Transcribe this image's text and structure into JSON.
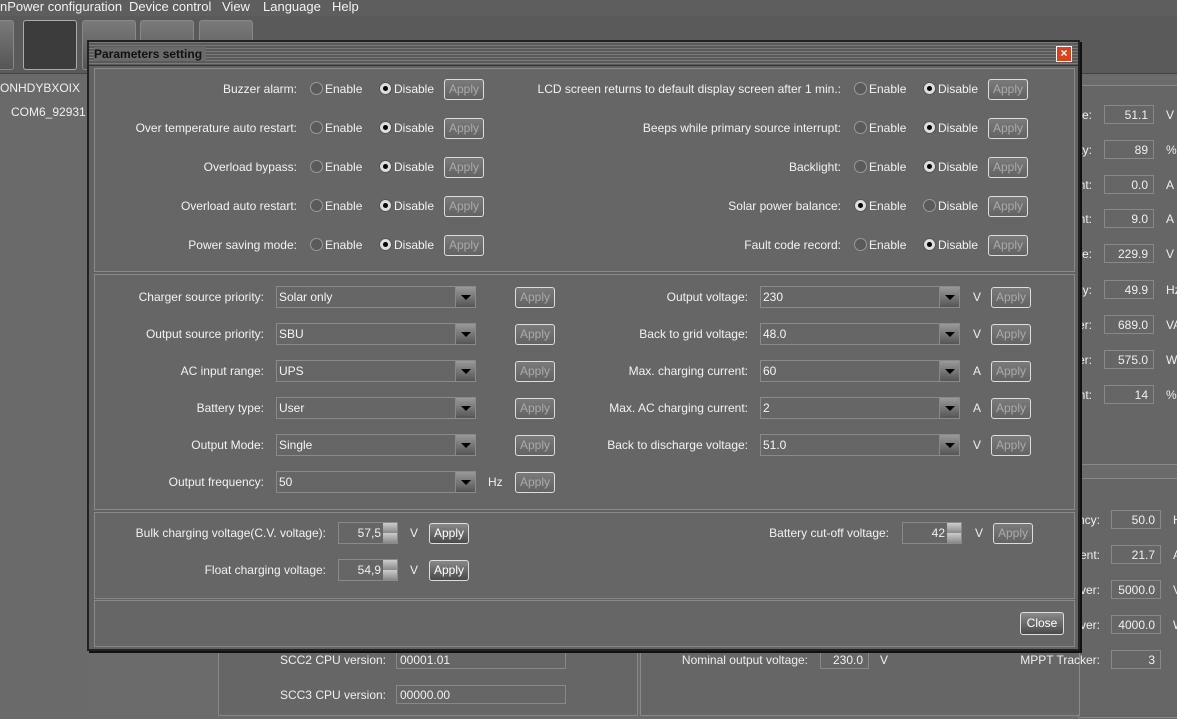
{
  "menu": [
    "nPower configuration",
    "Device control",
    "View",
    "Language",
    "Help"
  ],
  "tree": {
    "root": "ONHDYBXOIX",
    "device": "COM6_92931"
  },
  "background_right_top": [
    {
      "label": "e:",
      "value": "51.1",
      "unit": "V"
    },
    {
      "label": "ty:",
      "value": "89",
      "unit": "%"
    },
    {
      "label": "nt:",
      "value": "0.0",
      "unit": "A"
    },
    {
      "label": "nt:",
      "value": "9.0",
      "unit": "A"
    },
    {
      "label": "e:",
      "value": "229.9",
      "unit": "V"
    },
    {
      "label": "cy:",
      "value": "49.9",
      "unit": "Hz"
    },
    {
      "label": "er:",
      "value": "689.0",
      "unit": "VA"
    },
    {
      "label": "er:",
      "value": "575.0",
      "unit": "W"
    },
    {
      "label": "nt:",
      "value": "14",
      "unit": "%"
    }
  ],
  "background_right_bottom": [
    {
      "label": "ncy:",
      "value": "50.0",
      "unit": "H"
    },
    {
      "label": "ent:",
      "value": "21.7",
      "unit": "A"
    },
    {
      "label": "ver:",
      "value": "5000.0",
      "unit": "V"
    },
    {
      "label": "ver:",
      "value": "4000.0",
      "unit": "W"
    },
    {
      "label": "MPPT Tracker:",
      "value": "3",
      "unit": ""
    }
  ],
  "background_bottom": {
    "scc2_label": "SCC2 CPU version:",
    "scc2_value": "00001.01",
    "scc3_label": "SCC3 CPU version:",
    "scc3_value": "00000.00",
    "nominal_label": "Nominal output voltage:",
    "nominal_value": "230.0",
    "nominal_unit": "V"
  },
  "dialog": {
    "title": "Parameters setting",
    "close_label": "Close",
    "close_icon": "×",
    "enable_label": "Enable",
    "disable_label": "Disable",
    "apply_label": "Apply",
    "toggles_left": [
      {
        "label": "Buzzer alarm:",
        "value": "Disable"
      },
      {
        "label": "Over temperature auto restart:",
        "value": "Disable"
      },
      {
        "label": "Overload bypass:",
        "value": "Disable"
      },
      {
        "label": "Overload auto restart:",
        "value": "Disable"
      },
      {
        "label": "Power saving mode:",
        "value": "Disable"
      }
    ],
    "toggles_right": [
      {
        "label": "LCD screen returns to default display screen after 1 min.:",
        "value": "Disable"
      },
      {
        "label": "Beeps while primary source interrupt:",
        "value": "Disable"
      },
      {
        "label": "Backlight:",
        "value": "Disable"
      },
      {
        "label": "Solar power balance:",
        "value": "Enable"
      },
      {
        "label": "Fault code record:",
        "value": "Disable"
      }
    ],
    "selects_left": [
      {
        "label": "Charger source priority:",
        "value": "Solar only",
        "unit": ""
      },
      {
        "label": "Output source priority:",
        "value": "SBU",
        "unit": ""
      },
      {
        "label": "AC input range:",
        "value": "UPS",
        "unit": ""
      },
      {
        "label": "Battery type:",
        "value": "User",
        "unit": ""
      },
      {
        "label": "Output Mode:",
        "value": "Single",
        "unit": ""
      },
      {
        "label": "Output frequency:",
        "value": "50",
        "unit": "Hz"
      }
    ],
    "selects_right": [
      {
        "label": "Output voltage:",
        "value": "230",
        "unit": "V"
      },
      {
        "label": "Back to grid voltage:",
        "value": "48.0",
        "unit": "V"
      },
      {
        "label": "Max. charging current:",
        "value": "60",
        "unit": "A"
      },
      {
        "label": "Max. AC charging current:",
        "value": "2",
        "unit": "A"
      },
      {
        "label": "Back to discharge voltage:",
        "value": "51.0",
        "unit": "V"
      }
    ],
    "spinners": [
      {
        "label": "Bulk charging voltage(C.V. voltage):",
        "value": "57,5",
        "unit": "V",
        "apply_enabled": true
      },
      {
        "label": "Float charging voltage:",
        "value": "54,9",
        "unit": "V",
        "apply_enabled": true
      },
      {
        "label": "Battery cut-off voltage:",
        "value": "42",
        "unit": "V",
        "apply_enabled": false
      }
    ]
  }
}
